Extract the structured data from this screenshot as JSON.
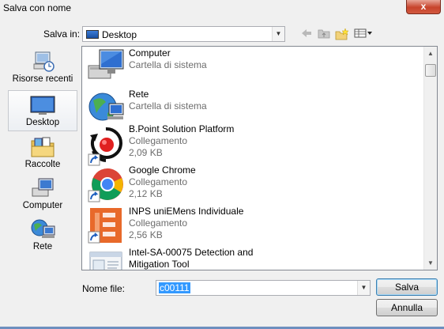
{
  "window": {
    "title": "Salva con nome",
    "close_label": "x"
  },
  "toolbar": {
    "save_in_label": "Salva in:",
    "save_in_value": "Desktop",
    "icons": [
      "back-arrow-icon",
      "up-folder-icon",
      "new-folder-icon",
      "view-menu-icon"
    ]
  },
  "places": [
    {
      "label": "Risorse recenti",
      "icon": "recent-places-icon"
    },
    {
      "label": "Desktop",
      "icon": "desktop-icon",
      "selected": true
    },
    {
      "label": "Raccolte",
      "icon": "libraries-icon"
    },
    {
      "label": "Computer",
      "icon": "computer-icon"
    },
    {
      "label": "Rete",
      "icon": "network-icon"
    }
  ],
  "files": [
    {
      "name": "Computer",
      "lines": [
        "Cartella di sistema"
      ],
      "icon": "computer-icon"
    },
    {
      "name": "Rete",
      "lines": [
        "Cartella di sistema"
      ],
      "icon": "network-icon"
    },
    {
      "name": "B.Point Solution Platform",
      "lines": [
        "Collegamento",
        "2,09 KB"
      ],
      "icon": "bpoint-icon"
    },
    {
      "name": "Google Chrome",
      "lines": [
        "Collegamento",
        "2,12 KB"
      ],
      "icon": "chrome-icon"
    },
    {
      "name": "INPS uniEMens Individuale",
      "lines": [
        "Collegamento",
        "2,56 KB"
      ],
      "icon": "inps-icon"
    },
    {
      "name": "Intel-SA-00075 Detection and Mitigation Tool",
      "name_lines": [
        "Intel-SA-00075 Detection and",
        "Mitigation Tool"
      ],
      "lines": [],
      "icon": "intel-tool-icon"
    }
  ],
  "filename": {
    "label": "Nome file:",
    "value": "c00111"
  },
  "buttons": {
    "save": "Salva",
    "cancel": "Annulla"
  }
}
